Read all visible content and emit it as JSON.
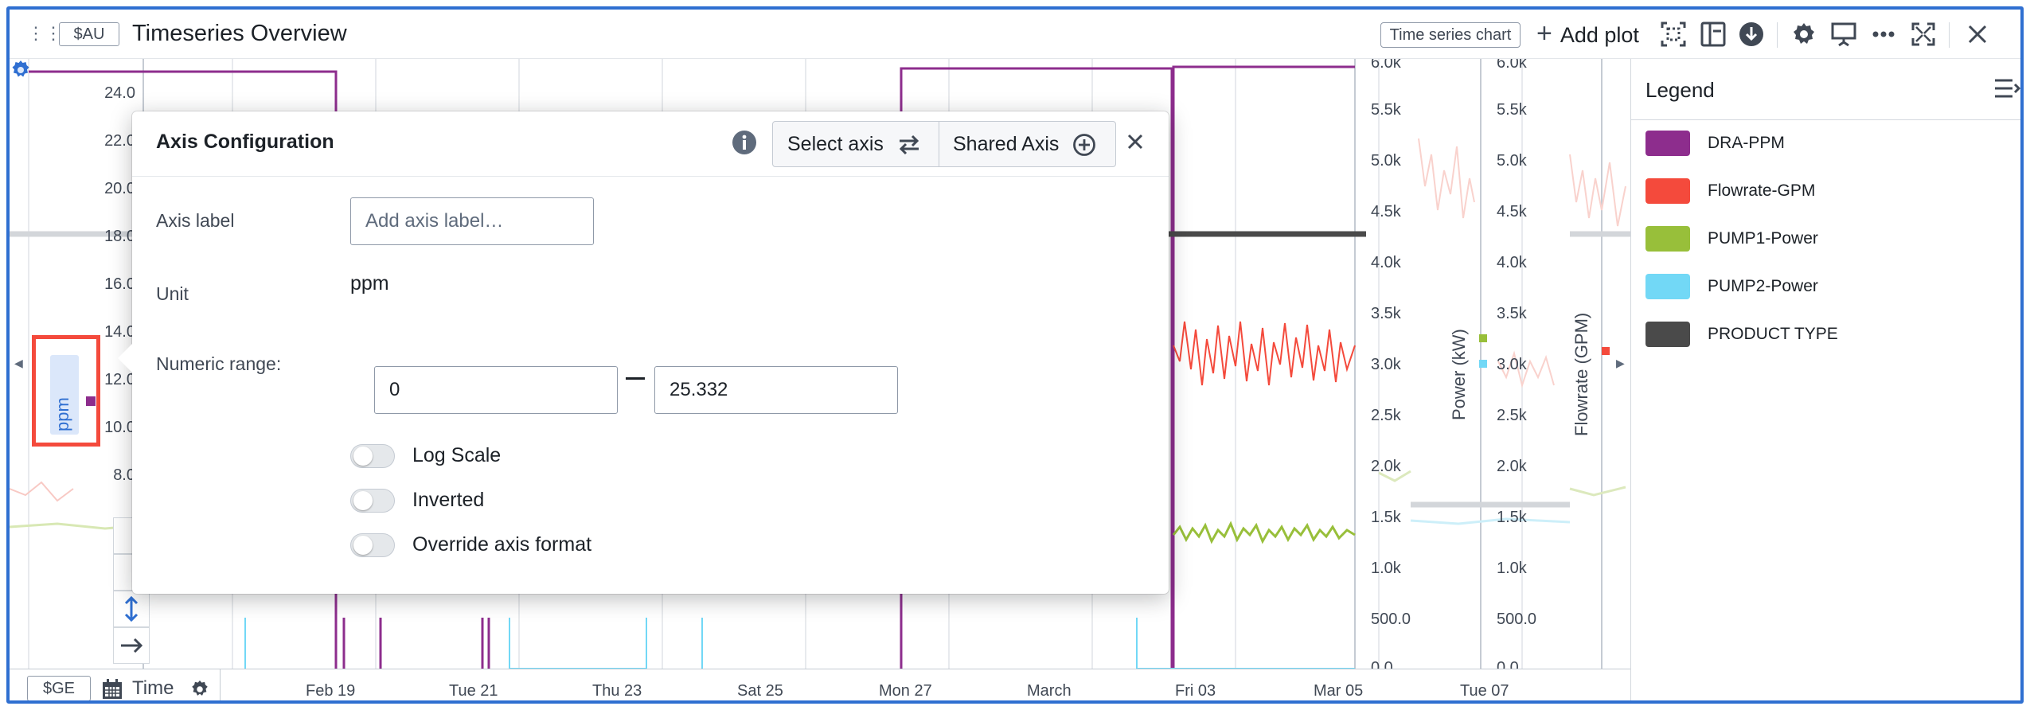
{
  "header": {
    "tag": "$AU",
    "title": "Timeseries Overview",
    "chart_type_badge": "Time series chart",
    "add_plot_label": "Add plot"
  },
  "left_axis": {
    "ticks": [
      "24.0",
      "22.0",
      "20.0",
      "18.0",
      "16.0",
      "14.0",
      "12.0",
      "10.0",
      "8.0"
    ],
    "unit_label": "ppm",
    "color": "#8d2d8d"
  },
  "right_axis_power": {
    "title": "Power (kW)",
    "ticks": [
      "6.0k",
      "5.5k",
      "5.0k",
      "4.5k",
      "4.0k",
      "3.5k",
      "3.0k",
      "2.5k",
      "2.0k",
      "1.5k",
      "1.0k",
      "500.0",
      "0.0"
    ]
  },
  "right_axis_flowrate": {
    "title": "Flowrate (GPM)",
    "ticks": [
      "6.0k",
      "5.5k",
      "5.0k",
      "4.5k",
      "4.0k",
      "3.5k",
      "3.0k",
      "2.5k",
      "2.0k",
      "1.5k",
      "1.0k",
      "500.0",
      "0.0"
    ]
  },
  "time_axis": {
    "tag": "$GE",
    "label": "Time",
    "ticks": [
      "Feb 19",
      "Tue 21",
      "Thu 23",
      "Sat 25",
      "Mon 27",
      "March",
      "Fri 03",
      "Mar 05",
      "Tue 07"
    ]
  },
  "legend": {
    "title": "Legend",
    "items": [
      {
        "label": "DRA-PPM",
        "color": "#8d2d8d"
      },
      {
        "label": "Flowrate-GPM",
        "color": "#f44a3c"
      },
      {
        "label": "PUMP1-Power",
        "color": "#98bf3a"
      },
      {
        "label": "PUMP2-Power",
        "color": "#72d8f6"
      },
      {
        "label": "PRODUCT TYPE",
        "color": "#4a4a4a"
      }
    ]
  },
  "dialog": {
    "title": "Axis Configuration",
    "select_axis_label": "Select axis",
    "shared_axis_label": "Shared Axis",
    "axis_label_field": {
      "label": "Axis label",
      "placeholder": "Add axis label…",
      "value": ""
    },
    "unit": {
      "label": "Unit",
      "value": "ppm"
    },
    "numeric_range": {
      "label": "Numeric range:",
      "min": "0",
      "max": "25.332"
    },
    "toggles": [
      {
        "label": "Log Scale",
        "on": false
      },
      {
        "label": "Inverted",
        "on": false
      },
      {
        "label": "Override axis format",
        "on": false
      }
    ]
  }
}
